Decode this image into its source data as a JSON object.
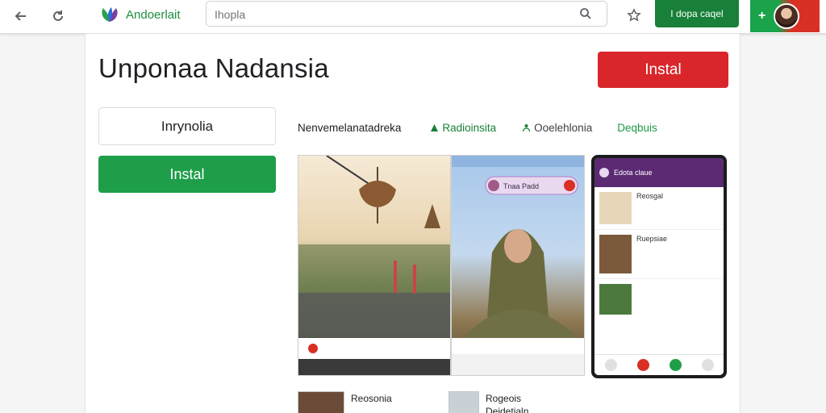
{
  "topbar": {
    "brand_name": "Andoerlait",
    "search_placeholder": "Ihopla",
    "chip_label": "I dopa caqel",
    "plus": "+"
  },
  "app": {
    "title": "Unponaa Nadansia",
    "install_red": "Instal",
    "secondary_button": "Inrynolia",
    "install_green": "Instal"
  },
  "tabs": [
    {
      "label": "Nenvemelanatadreka"
    },
    {
      "label": "Radioinsita"
    },
    {
      "label": "Ooelehlonia"
    },
    {
      "label": "Deqbuis"
    }
  ],
  "screenshots": {
    "chip_text": "Tnaa Padd"
  },
  "phone": {
    "header_title": "Edota claue",
    "items": [
      {
        "title": "Reosgal"
      },
      {
        "title": "Ruepsiae"
      }
    ]
  },
  "people": [
    {
      "name": "Reosonia"
    },
    {
      "name": "Rogeois",
      "sub": "Deidetialn"
    }
  ],
  "colors": {
    "brand_green": "#1e8e3e",
    "install_red": "#d9262a",
    "install_green": "#1e9e48",
    "phone_header": "#5b2a73"
  }
}
